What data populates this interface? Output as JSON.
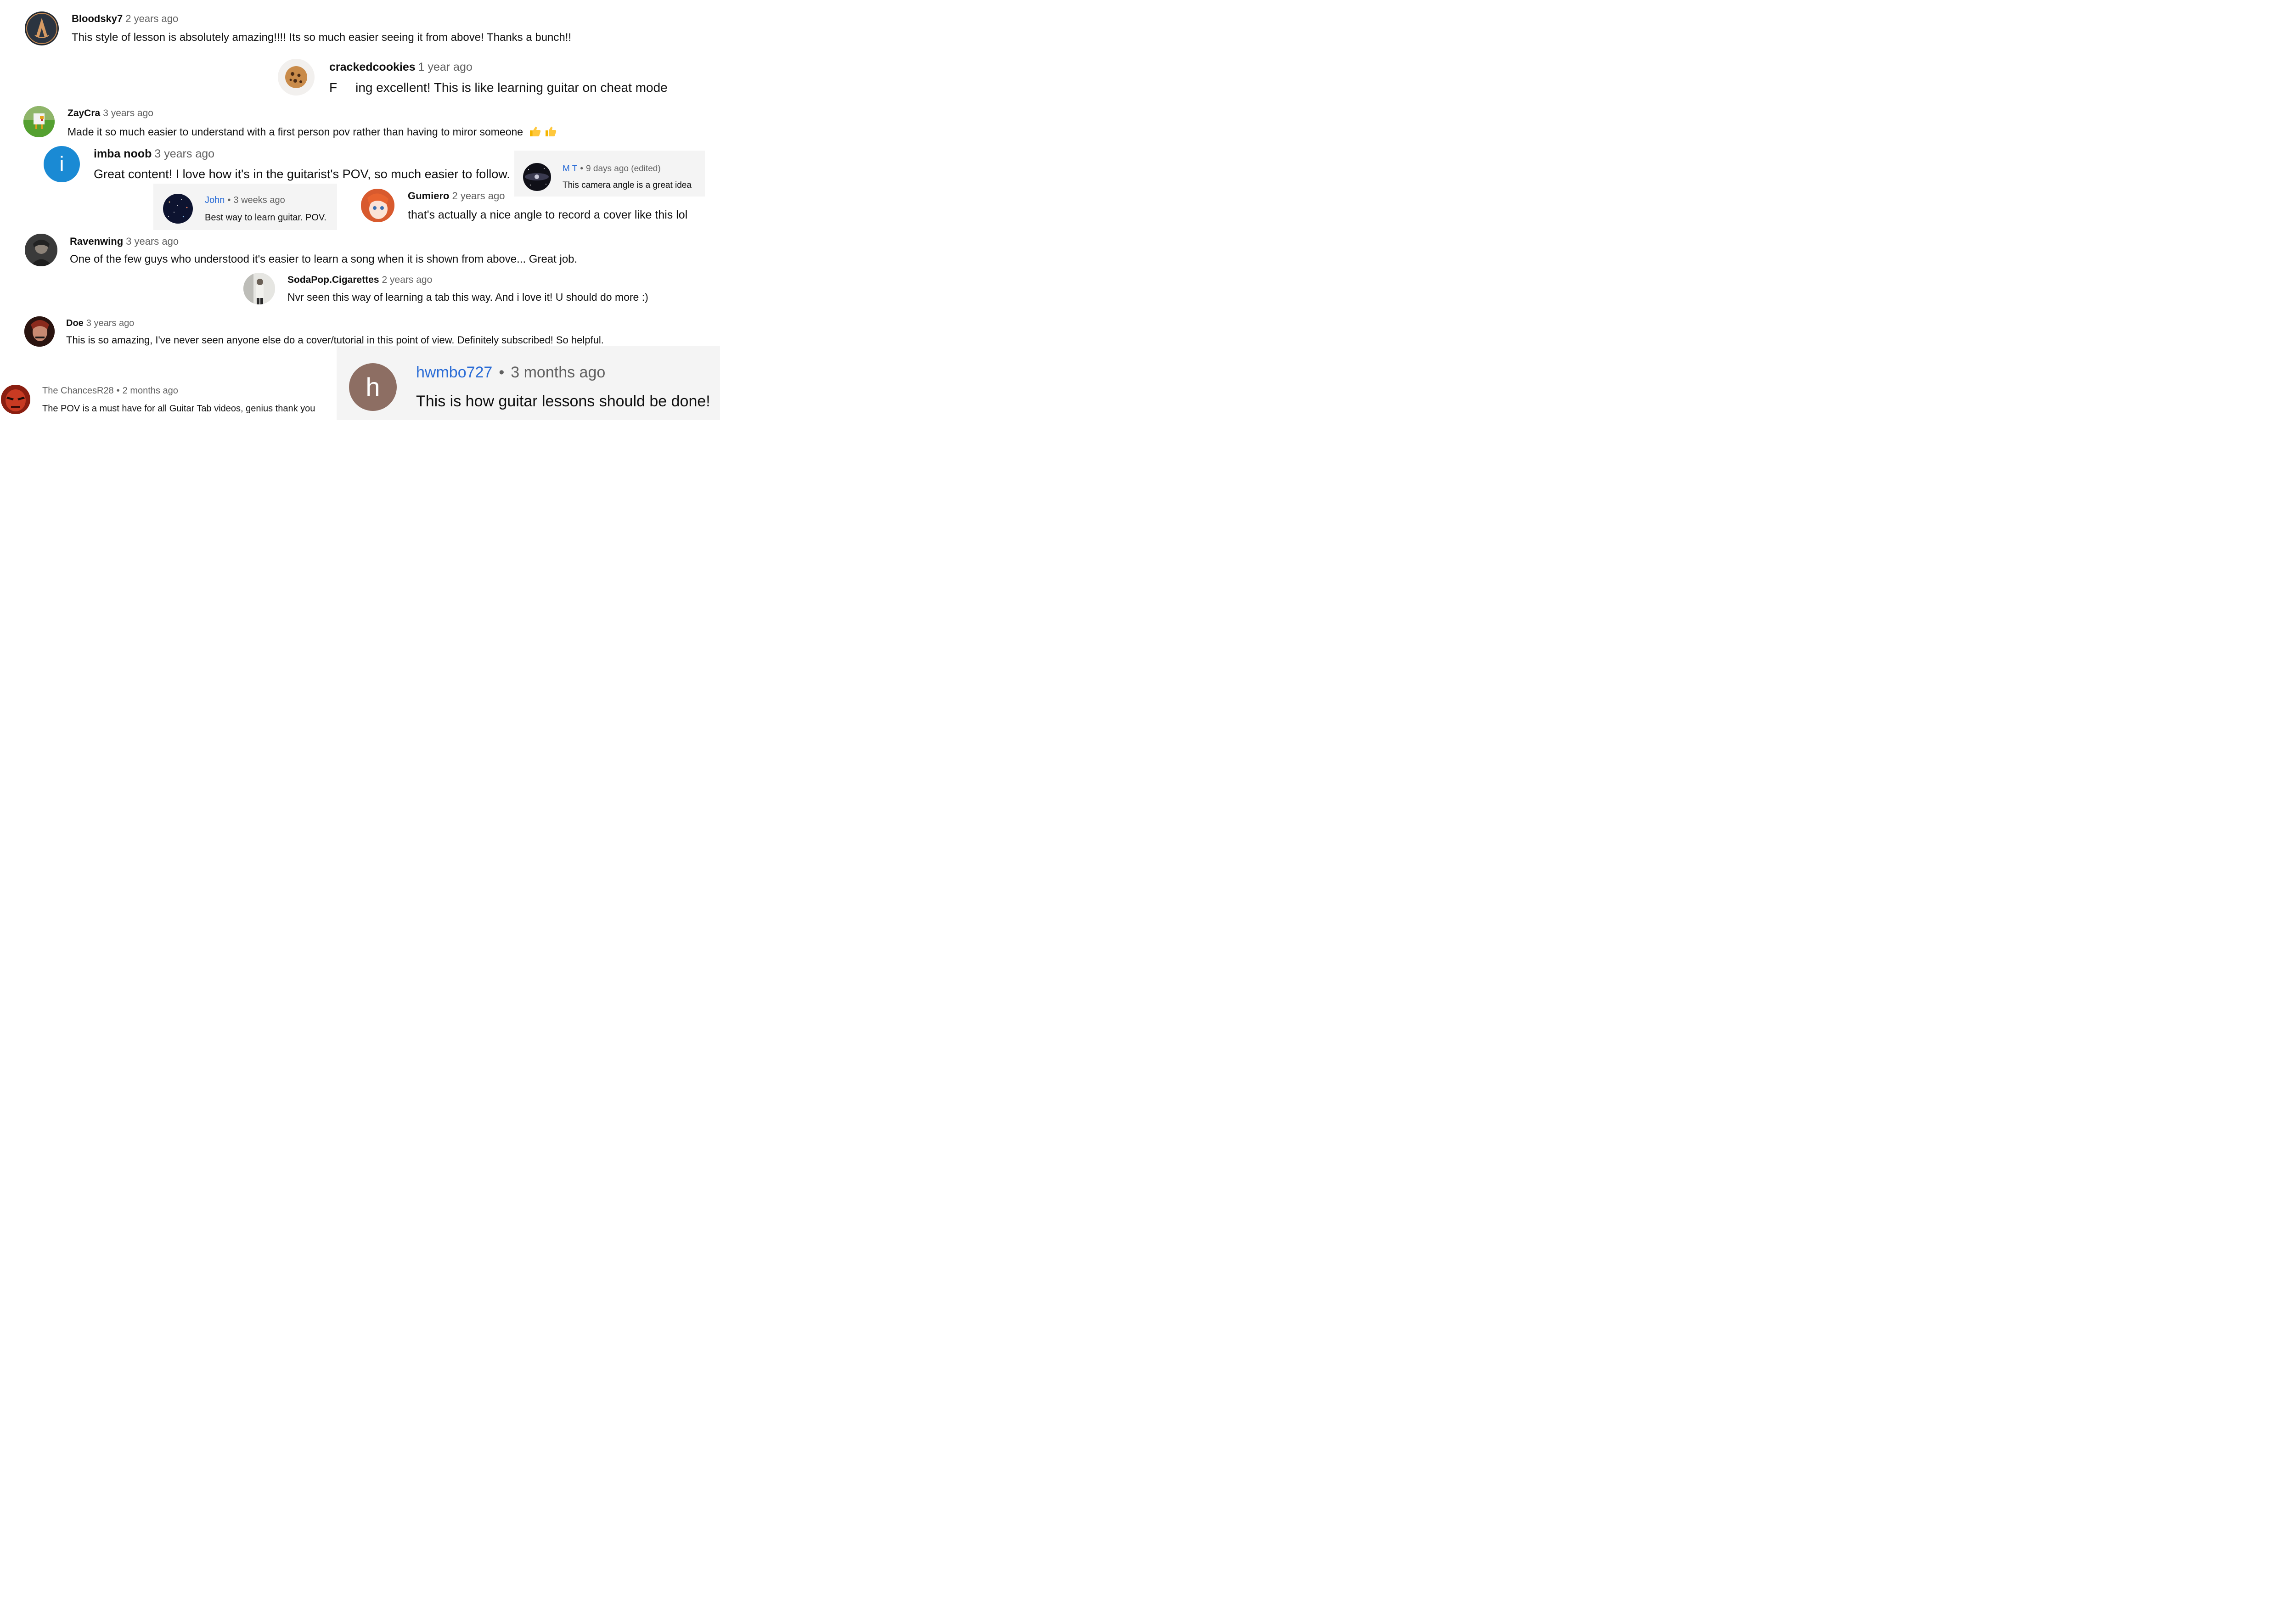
{
  "comments": [
    {
      "author": "Bloodsky7",
      "time": "2 years ago",
      "text": "This style of lesson is absolutely amazing!!!! Its so much easier seeing it from above! Thanks a bunch!!",
      "avatar_icon": "assassin-emblem-icon"
    },
    {
      "author": "crackedcookies",
      "time": "1 year ago",
      "text_pre": "F",
      "text_post": "ing excellent! This is like learning guitar on cheat mode",
      "avatar_icon": "cookie-icon"
    },
    {
      "author": "ZayCra",
      "time": "3 years ago",
      "text": "Made it so much easier to understand with a first person pov rather than having to miror someone",
      "emoji": "thumbs-up-emoji x2",
      "avatar_icon": "blocky-chicken-icon"
    },
    {
      "author": "imba noob",
      "time": "3 years ago",
      "text": "Great content! I love how it's in the guitarist's POV, so much easier to follow.",
      "avatar_letter": "i",
      "avatar_color": "#1a8ad4"
    },
    {
      "author": "M T",
      "time": "9 days ago (edited)",
      "text": "This camera angle is a great idea",
      "avatar_icon": "galaxy-icon"
    },
    {
      "author": "John",
      "time": "3 weeks ago",
      "text": "Best way to learn guitar. POV.",
      "avatar_icon": "starfield-icon"
    },
    {
      "author": "Gumiero",
      "time": "2 years ago",
      "text": "that's actually a nice angle to record a cover like this lol",
      "avatar_icon": "anime-girl-icon"
    },
    {
      "author": "Ravenwing",
      "time": "3 years ago",
      "text": "One of the few guys who understood it's easier to learn a song when it is shown from above... Great job.",
      "avatar_icon": "person-photo-icon"
    },
    {
      "author": "SodaPop.Cigarettes",
      "time": "2 years ago",
      "text": "Nvr seen this way of learning a tab this way. And i love it! U should do more :)",
      "avatar_icon": "person-photo-icon"
    },
    {
      "author": "Doe",
      "time": "3 years ago",
      "text": "This is so amazing, I've never seen anyone else do a cover/tutorial in this point of view. Definitely subscribed! So helpful.",
      "avatar_icon": "person-photo-icon"
    },
    {
      "author": "The ChancesR28",
      "time": "2 months ago",
      "text": "The POV is a must have for all Guitar Tab videos, genius thank you",
      "avatar_icon": "red-mask-icon"
    },
    {
      "author": "hwmbo727",
      "time": "3 months ago",
      "text": "This is how guitar lessons should be done!",
      "avatar_letter": "h",
      "avatar_color": "#8d6e63"
    }
  ],
  "separator": "•",
  "colors": {
    "link_blue": "#2a6cd6",
    "meta_gray": "#606060",
    "panel_bg": "#f4f4f4"
  }
}
